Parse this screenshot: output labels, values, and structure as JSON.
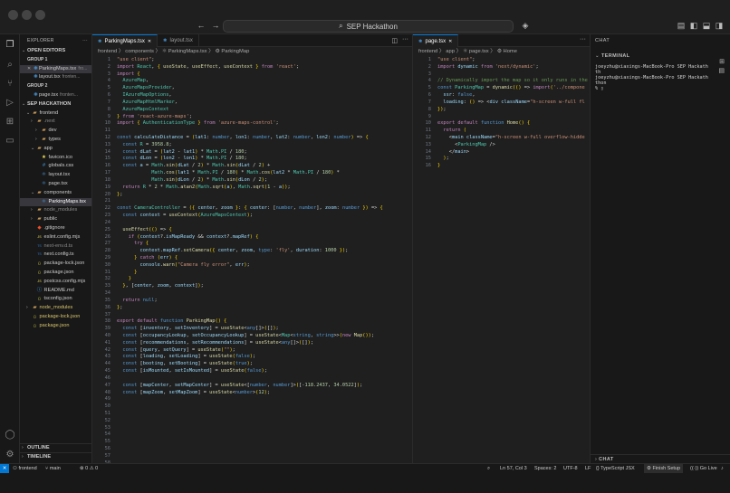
{
  "title_bar": {
    "search": "SEP Hackathon"
  },
  "explorer": {
    "title": "EXPLORER",
    "open_editors": "OPEN EDITORS",
    "group1": "GROUP 1",
    "group1_files": [
      {
        "name": "ParkingMaps.tsx",
        "meta": "fro..."
      },
      {
        "name": "layout.tsx",
        "meta": "fronten..."
      }
    ],
    "group2": "GROUP 2",
    "group2_files": [
      {
        "name": "page.tsx",
        "meta": "fronten..."
      }
    ],
    "project": "SEP HACKATHON",
    "tree": [
      {
        "label": "frontend",
        "depth": 1,
        "kind": "folder",
        "open": true
      },
      {
        "label": ".next",
        "depth": 2,
        "kind": "folder",
        "open": false
      },
      {
        "label": "dev",
        "depth": 3,
        "kind": "folder",
        "open": false
      },
      {
        "label": "types",
        "depth": 3,
        "kind": "folder",
        "open": false
      },
      {
        "label": "app",
        "depth": 2,
        "kind": "folder",
        "open": true
      },
      {
        "label": "favicon.ico",
        "depth": 3,
        "kind": "ico"
      },
      {
        "label": "globals.css",
        "depth": 3,
        "kind": "css"
      },
      {
        "label": "layout.tsx",
        "depth": 3,
        "kind": "tsx"
      },
      {
        "label": "page.tsx",
        "depth": 3,
        "kind": "tsx"
      },
      {
        "label": "components",
        "depth": 2,
        "kind": "folder",
        "open": true
      },
      {
        "label": "ParkingMaps.tsx",
        "depth": 3,
        "kind": "tsx",
        "selected": true
      },
      {
        "label": "node_modules",
        "depth": 2,
        "kind": "folder",
        "open": false
      },
      {
        "label": "public",
        "depth": 2,
        "kind": "folder",
        "open": false
      },
      {
        "label": ".gitignore",
        "depth": 2,
        "kind": "git"
      },
      {
        "label": "eslint.config.mjs",
        "depth": 2,
        "kind": "js"
      },
      {
        "label": "next-env.d.ts",
        "depth": 2,
        "kind": "ts"
      },
      {
        "label": "next.config.ts",
        "depth": 2,
        "kind": "ts"
      },
      {
        "label": "package-lock.json",
        "depth": 2,
        "kind": "json"
      },
      {
        "label": "package.json",
        "depth": 2,
        "kind": "json"
      },
      {
        "label": "postcss.config.mjs",
        "depth": 2,
        "kind": "js"
      },
      {
        "label": "README.md",
        "depth": 2,
        "kind": "md"
      },
      {
        "label": "tsconfig.json",
        "depth": 2,
        "kind": "json"
      },
      {
        "label": "node_modules",
        "depth": 1,
        "kind": "folder",
        "open": false
      },
      {
        "label": "package-lock.json",
        "depth": 1,
        "kind": "json"
      },
      {
        "label": "package.json",
        "depth": 1,
        "kind": "json"
      }
    ],
    "outline": "OUTLINE",
    "timeline": "TIMELINE"
  },
  "editor1": {
    "tabs": [
      {
        "label": "ParkingMaps.tsx",
        "active": true
      },
      {
        "label": "layout.tsx",
        "active": false
      }
    ],
    "breadcrumb": "frontend 〉 components 〉 ⚛ ParkingMaps.tsx 〉 ⚙ ParkingMap",
    "lines": [
      "\"use client\";",
      "import React, { useState, useEffect, useContext } from 'react';",
      "import {",
      "  AzureMap,",
      "  AzureMapsProvider,",
      "  IAzureMapOptions,",
      "  AzureMapHtmlMarker,",
      "  AzureMapsContext",
      "} from 'react-azure-maps';",
      "import { AuthenticationType } from 'azure-maps-control';",
      "",
      "const calculateDistance = (lat1: number, lon1: number, lat2: number, lon2: number) => {",
      "  const R = 3958.8;",
      "  const dLat = (lat2 - lat1) * Math.PI / 180;",
      "  const dLon = (lon2 - lon1) * Math.PI / 180;",
      "  const a = Math.sin(dLat / 2) * Math.sin(dLat / 2) +",
      "            Math.cos(lat1 * Math.PI / 180) * Math.cos(lat2 * Math.PI / 180) *",
      "            Math.sin(dLon / 2) * Math.sin(dLon / 2);",
      "  return R * 2 * Math.atan2(Math.sqrt(a), Math.sqrt(1 - a));",
      "};",
      "",
      "const CameraController = ({ center, zoom }: { center: [number, number], zoom: number }) => {",
      "  const context = useContext(AzureMapsContext);",
      "",
      "  useEffect(() => {",
      "    if (context?.isMapReady && context?.mapRef) {",
      "      try {",
      "        context.mapRef.setCamera({ center, zoom, type: 'fly', duration: 1000 });",
      "      } catch (err) {",
      "        console.warn(\"Camera fly error\", err);",
      "      }",
      "    }",
      "  }, [center, zoom, context]);",
      "",
      "  return null;",
      "};",
      "",
      "export default function ParkingMap() {",
      "  const [inventory, setInventory] = useState<any[]>([]);",
      "  const [occupancyLookup, setOccupancyLookup] = useState<Map<string, string>>(new Map());",
      "  const [recommendations, setRecommendations] = useState<any[]>([]);",
      "  const [query, setQuery] = useState(\"\");",
      "  const [loading, setLoading] = useState(false);",
      "  const [booting, setBooting] = useState(true);",
      "  const [isMounted, setIsMounted] = useState(false);",
      "",
      "  const [mapCenter, setMapCenter] = useState<[number, number]>([-118.2437, 34.0522]);",
      "  const [mapZoom, setMapZoom] = useState<number>(12);",
      "",
      "",
      "",
      "",
      "",
      "",
      "",
      "",
      "",
      ""
    ]
  },
  "editor2": {
    "tabs": [
      {
        "label": "page.tsx",
        "active": true
      }
    ],
    "breadcrumb": "frontend 〉 app 〉 ⚛ page.tsx 〉 ⚙ Home",
    "lines": [
      "\"use client\";",
      "import dynamic from 'next/dynamic';",
      "",
      "// Dynamically import the map so it only runs in the",
      "const ParkingMap = dynamic(() => import('../compone",
      "  ssr: false,",
      "  loading: () => <div className=\"h-screen w-full fl",
      "});",
      "",
      "export default function Home() {",
      "  return (",
      "    <main className=\"h-screen w-full overflow-hidde",
      "      <ParkingMap />",
      "    </main>",
      "  );",
      "}"
    ]
  },
  "chat": {
    "title": "CHAT",
    "terminal_title": "TERMINAL",
    "terminal_lines": [
      "joeyzhu@xiaxings-MacBook-Pro SEP Hackath",
      "th",
      "joeyzhu@xiaxings-MacBook-Pro SEP Hackath",
      "thon",
      "% ▯"
    ],
    "bottom_title": "CHAT"
  },
  "status": {
    "remote": "✕",
    "folder": "frontend",
    "branch": "main",
    "problems": "⊗ 0 ⚠ 0",
    "position": "Ln 57, Col 3",
    "spaces": "Spaces: 2",
    "encoding": "UTF-8",
    "eol": "LF",
    "language": "{} TypeScript JSX",
    "finish_setup": "Finish Setup",
    "go_live": "Go Live"
  },
  "colors": {
    "accent": "#0078d4",
    "background": "#1f1f1f",
    "sidebar": "#181818"
  }
}
